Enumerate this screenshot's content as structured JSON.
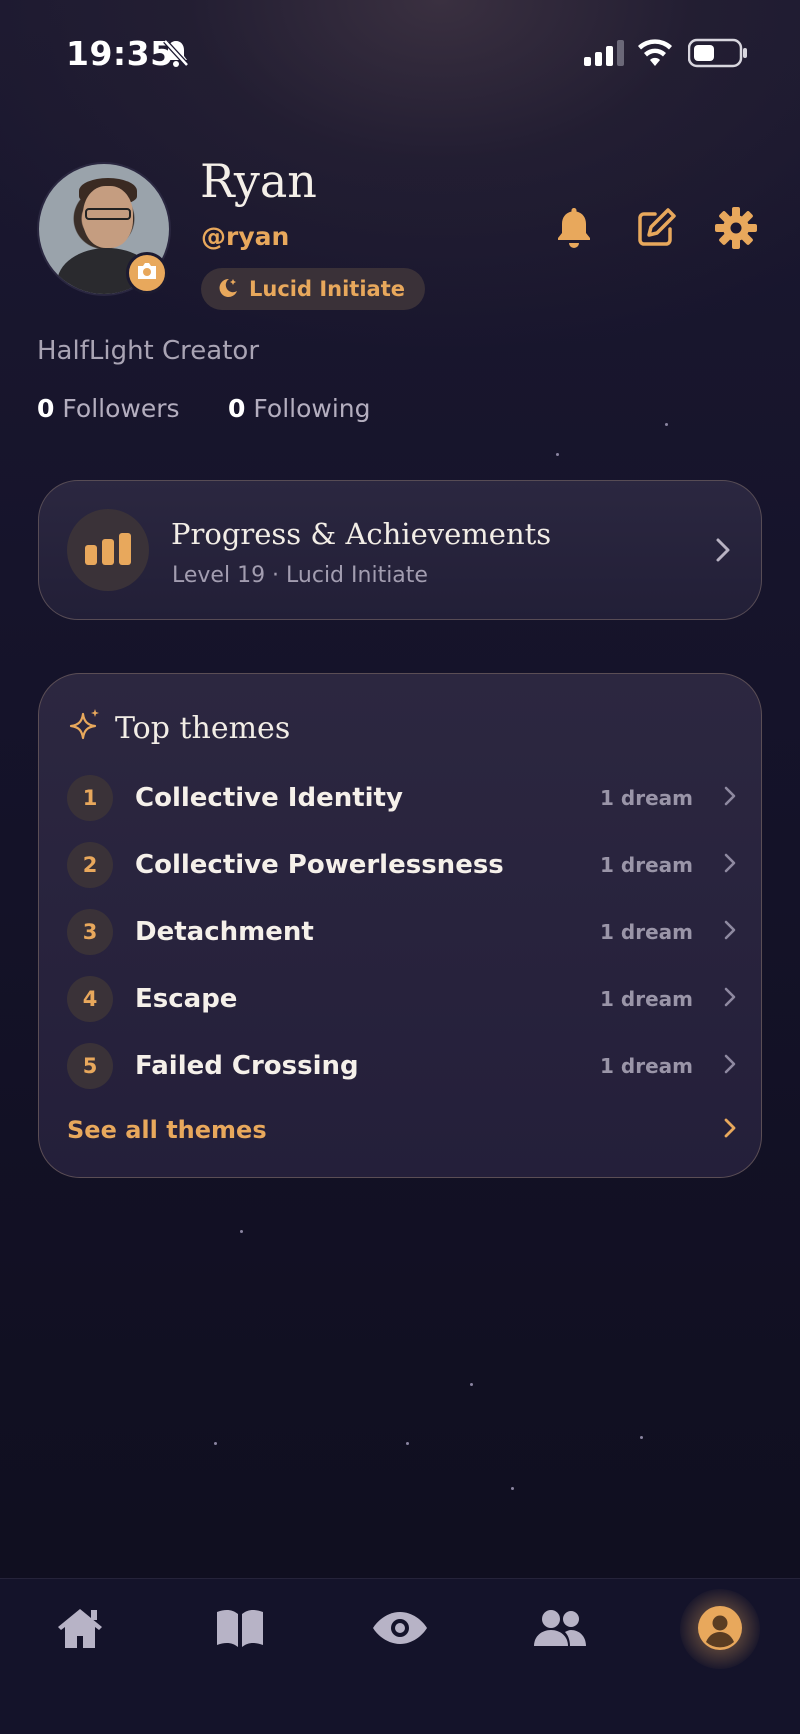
{
  "status_bar": {
    "time": "19:35",
    "icons": [
      "bell-slash-icon",
      "signal-icon",
      "wifi-icon",
      "battery-icon"
    ]
  },
  "profile": {
    "name": "Ryan",
    "handle": "@ryan",
    "rank_badge": "Lucid Initiate",
    "bio": "HalfLight Creator",
    "followers_count": "0",
    "followers_label": "Followers",
    "following_count": "0",
    "following_label": "Following"
  },
  "header_actions": [
    "bell-icon",
    "edit-icon",
    "gear-icon"
  ],
  "progress": {
    "title": "Progress & Achievements",
    "subtitle": "Level 19 · Lucid Initiate"
  },
  "themes": {
    "title": "Top themes",
    "items": [
      {
        "rank": "1",
        "name": "Collective Identity",
        "count": "1 dream"
      },
      {
        "rank": "2",
        "name": "Collective Powerlessness",
        "count": "1 dream"
      },
      {
        "rank": "3",
        "name": "Detachment",
        "count": "1 dream"
      },
      {
        "rank": "4",
        "name": "Escape",
        "count": "1 dream"
      },
      {
        "rank": "5",
        "name": "Failed Crossing",
        "count": "1 dream"
      }
    ],
    "see_all": "See all themes"
  },
  "tabbar": {
    "tabs": [
      "home-icon",
      "book-icon",
      "eye-icon",
      "users-icon",
      "profile-icon"
    ],
    "active": "profile-icon"
  },
  "colors": {
    "accent": "#e8a85c",
    "background": "#15132a",
    "card": "#262139"
  }
}
